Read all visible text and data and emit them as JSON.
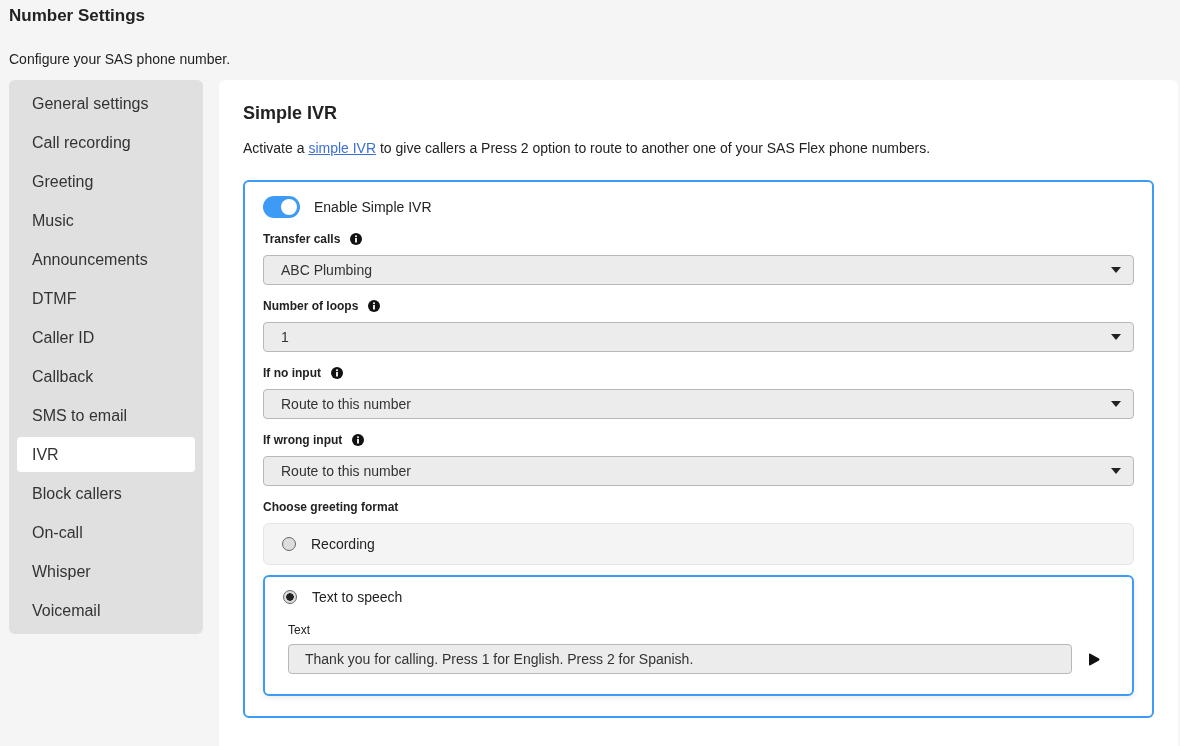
{
  "page": {
    "title": "Number Settings",
    "subtitle": "Configure your SAS phone number."
  },
  "sidebar": {
    "items": [
      {
        "label": "General settings",
        "selected": false
      },
      {
        "label": "Call recording",
        "selected": false
      },
      {
        "label": "Greeting",
        "selected": false
      },
      {
        "label": "Music",
        "selected": false
      },
      {
        "label": "Announcements",
        "selected": false
      },
      {
        "label": "DTMF",
        "selected": false
      },
      {
        "label": "Caller ID",
        "selected": false
      },
      {
        "label": "Callback",
        "selected": false
      },
      {
        "label": "SMS to email",
        "selected": false
      },
      {
        "label": "IVR",
        "selected": true
      },
      {
        "label": "Block callers",
        "selected": false
      },
      {
        "label": "On-call",
        "selected": false
      },
      {
        "label": "Whisper",
        "selected": false
      },
      {
        "label": "Voicemail",
        "selected": false
      }
    ]
  },
  "panel": {
    "title": "Simple IVR",
    "description_before": "Activate a ",
    "description_link": "simple IVR",
    "description_after": " to give callers a Press 2 option to route to another one of your SAS Flex phone numbers.",
    "toggle": {
      "label": "Enable Simple IVR",
      "on": true
    },
    "selects": [
      {
        "label": "Transfer calls",
        "value": "ABC Plumbing"
      },
      {
        "label": "Number of loops",
        "value": "1"
      },
      {
        "label": "If no input",
        "value": "Route to this number"
      },
      {
        "label": "If wrong input",
        "value": "Route to this number"
      }
    ],
    "greeting_label": "Choose greeting format",
    "options": [
      {
        "label": "Recording",
        "selected": false
      },
      {
        "label": "Text to speech",
        "selected": true,
        "field_label": "Text",
        "field_value": "Thank you for calling. Press 1 for English. Press 2 for Spanish."
      }
    ]
  }
}
